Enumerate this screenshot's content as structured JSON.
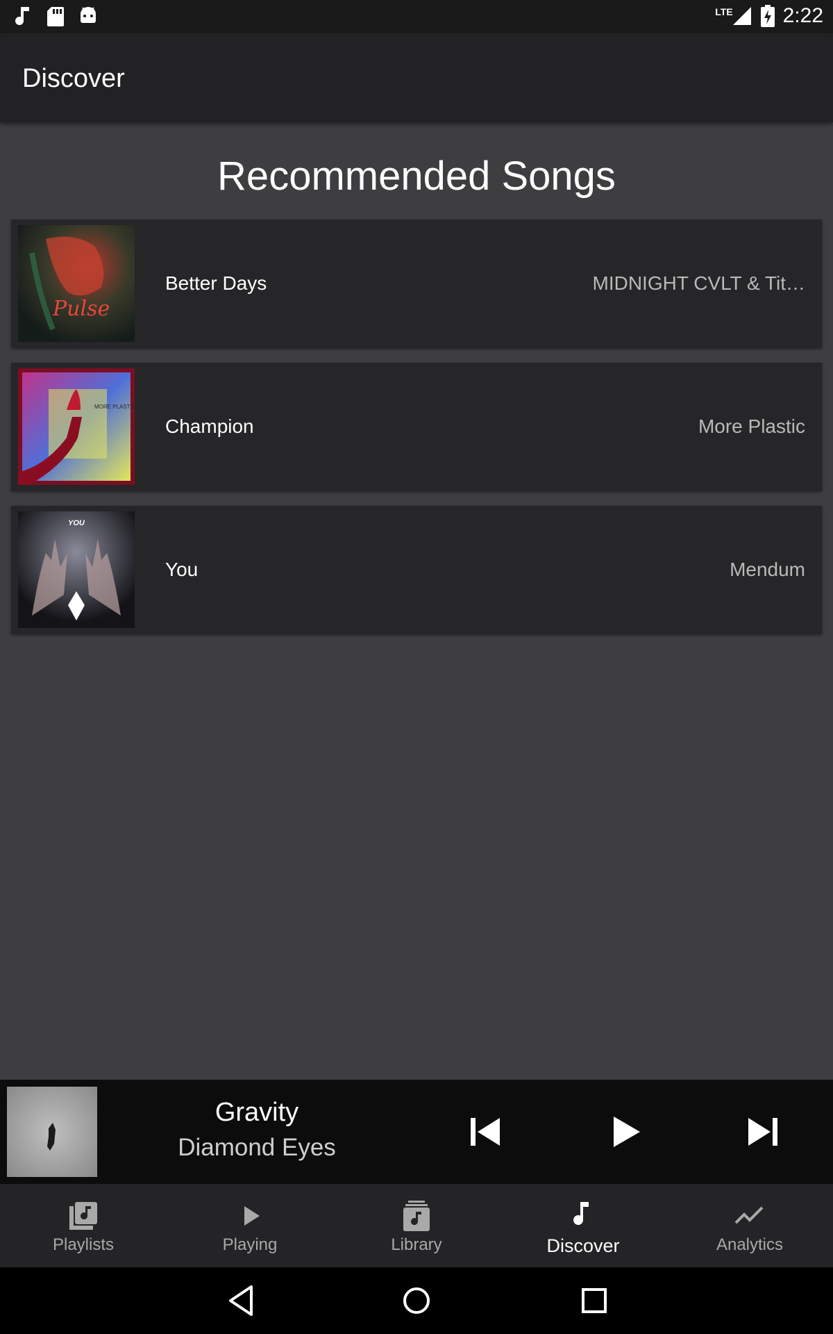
{
  "status_bar": {
    "time": "2:22",
    "network": "LTE"
  },
  "app_bar": {
    "title": "Discover"
  },
  "section": {
    "title": "Recommended Songs"
  },
  "songs": [
    {
      "title": "Better Days",
      "artist": "MIDNIGHT CVLT & Tit…",
      "art_text": "Pulse"
    },
    {
      "title": "Champion",
      "artist": "More Plastic",
      "art_text": "MORE PLASTIC"
    },
    {
      "title": "You",
      "artist": "Mendum",
      "art_text": "YOU"
    }
  ],
  "now_playing": {
    "title": "Gravity",
    "artist": "Diamond Eyes"
  },
  "bottom_nav": [
    {
      "label": "Playlists",
      "icon": "playlists-icon",
      "active": false
    },
    {
      "label": "Playing",
      "icon": "play-icon",
      "active": false
    },
    {
      "label": "Library",
      "icon": "library-icon",
      "active": false
    },
    {
      "label": "Discover",
      "icon": "music-note-icon",
      "active": true
    },
    {
      "label": "Analytics",
      "icon": "trending-icon",
      "active": false
    }
  ],
  "colors": {
    "background": "#3e3e40",
    "app_bar": "#222224",
    "row": "#262628",
    "player_bar": "#0c0c0c",
    "nav_bar": "#242426"
  }
}
